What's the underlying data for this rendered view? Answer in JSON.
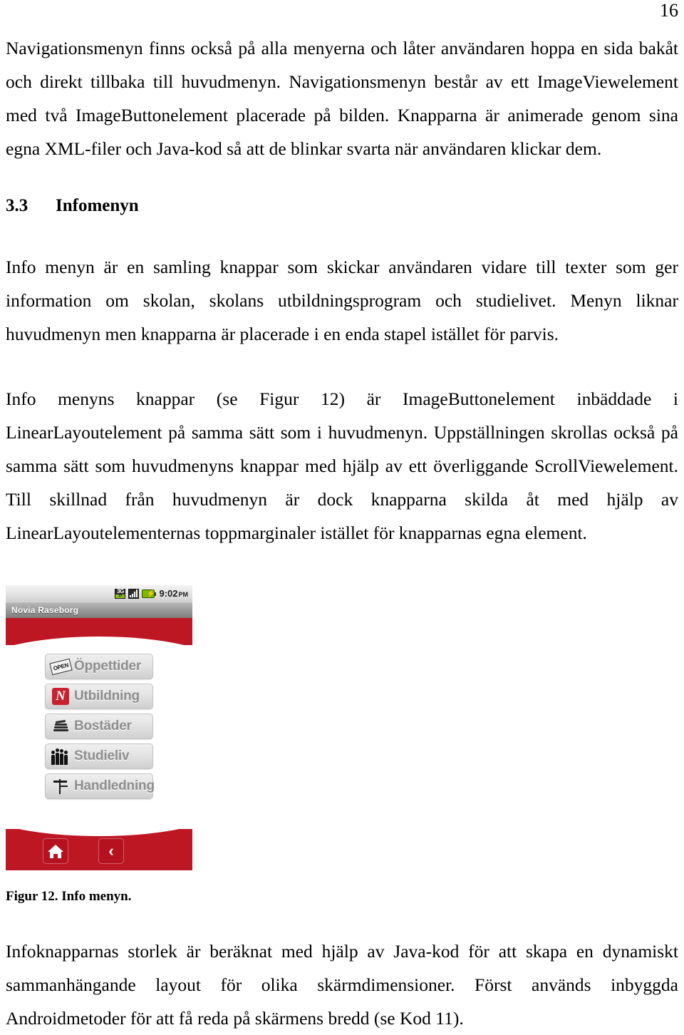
{
  "page": {
    "number": "16"
  },
  "paragraphs": {
    "p1": "Navigationsmenyn finns också på alla menyerna och låter användaren hoppa en sida bakåt och direkt tillbaka till huvudmenyn. Navigationsmenyn består av ett ImageViewelement med två ImageButtonelement placerade på bilden. Knapparna är animerade genom sina egna XML-filer och Java-kod så att de blinkar svarta när användaren klickar dem.",
    "p2": "Info menyn är en samling knappar som skickar användaren vidare till texter som ger information om skolan, skolans utbildningsprogram och studielivet. Menyn liknar huvudmenyn men knapparna är placerade i en enda stapel istället för parvis.",
    "p3": "Info menyns knappar (se Figur 12) är ImageButtonelement inbäddade i LinearLayoutelement på samma sätt som i huvudmenyn. Uppställningen skrollas också på samma sätt som huvudmenyns knappar med hjälp av ett överliggande ScrollViewelement. Till skillnad från huvudmenyn är dock knapparna skilda åt med hjälp av LinearLayoutelementernas toppmarginaler istället för knapparnas egna element.",
    "p4": "Infoknapparnas storlek är beräknat med hjälp av Java-kod för att skapa en dynamiskt sammanhängande layout för olika skärmdimensioner. Först används inbyggda Androidmetoder för att få reda på skärmens bredd (se Kod 11)."
  },
  "heading": {
    "number": "3.3",
    "title": "Infomenyn"
  },
  "figure": {
    "caption": "Figur 12. Info menyn.",
    "screenshot": {
      "statusbar": {
        "network_label_top": "3G",
        "network_label_bottom": "1X",
        "time": "9:02",
        "ampm": "PM"
      },
      "titlebar": {
        "title": "Novia Raseborg"
      },
      "menu_buttons": [
        {
          "label": "Öppettider",
          "icon": "open-sign-icon",
          "icon_text": "OPEN"
        },
        {
          "label": "Utbildning",
          "icon": "novia-n-logo-icon",
          "icon_text": "N"
        },
        {
          "label": "Bostäder",
          "icon": "books-stack-icon",
          "icon_text": ""
        },
        {
          "label": "Studieliv",
          "icon": "people-group-icon",
          "icon_text": ""
        },
        {
          "label": "Handledning",
          "icon": "signpost-icon",
          "icon_text": ""
        }
      ],
      "nav_buttons": [
        {
          "name": "home",
          "icon": "home-icon",
          "glyph": ""
        },
        {
          "name": "back",
          "icon": "chevron-left-icon",
          "glyph": "‹"
        }
      ],
      "colors": {
        "brand_red": "#bc1722",
        "button_gray": "#e4e4e4",
        "label_gray": "#8e8e8e"
      }
    }
  }
}
